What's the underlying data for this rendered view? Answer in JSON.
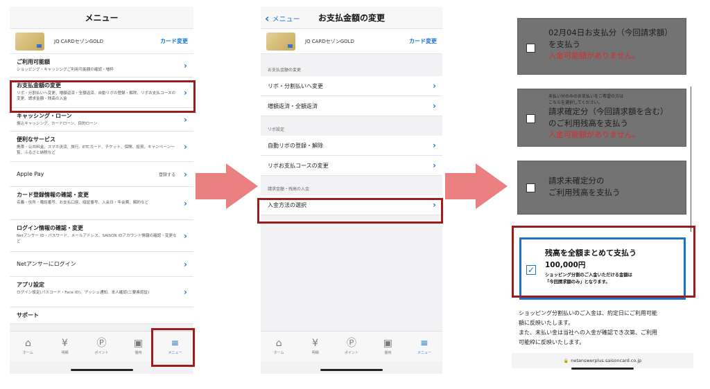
{
  "colors": {
    "accent": "#1a73d9",
    "highlight": "#9b1c1c",
    "arrow": "#ea7f80",
    "selected_border": "#1b74c9",
    "warning": "#d92b2b",
    "disabled_box": "#737373"
  },
  "screen1": {
    "title": "メニュー",
    "card": {
      "name": "JQ CARDセゾンGOLD",
      "change_label": "カード変更"
    },
    "items": [
      {
        "title": "ご利用可能額",
        "sub": "ショッピング・キャッシングご利用可能額の確認・増枠"
      },
      {
        "title": "お支払金額の変更",
        "sub": "リボ・分割払いへ変更、増額返済・全額返済、自動リボの登録・解除、リボお支払コースの変更、請求金額・残高の入金"
      },
      {
        "title": "キャッシング・ローン",
        "sub": "振込キャッシング、カードローン、目的ローン"
      },
      {
        "title": "便利なサービス",
        "sub": "携帯・公共料金、スマホ決済、旅行、ETCカード、チケット、保険、投資、キャンペーン一覧、ふるさと納税など"
      },
      {
        "title": "Apple Pay",
        "sub": "",
        "note": "登録する"
      },
      {
        "title": "カード登録情報の確認・変更",
        "sub": "名義・住所・電話番号、お支払口座、暗証番号、入会日・年会費、解約など"
      },
      {
        "title": "ログイン情報の確認・変更",
        "sub": "Netアンサー ID・パスワード、メールアドレス、SAISON IDアカウント情報の確認・変更など"
      },
      {
        "title": "Netアンサーにログイン",
        "sub": ""
      },
      {
        "title": "アプリ設定",
        "sub": "ログイン設定(パスコード・Face ID)、プッシュ通知、本人確認(二要素認証)"
      },
      {
        "title": "サポート",
        "sub": ""
      }
    ]
  },
  "tabs": [
    {
      "label": "ホーム",
      "icon": "house-icon"
    },
    {
      "label": "明細",
      "icon": "yen-icon"
    },
    {
      "label": "ポイント",
      "icon": "point-icon"
    },
    {
      "label": "優待",
      "icon": "gift-icon"
    },
    {
      "label": "メニュー",
      "icon": "menu-icon"
    }
  ],
  "screen2": {
    "back_label": "メニュー",
    "title": "お支払金額の変更",
    "card": {
      "name": "JQ CARDセゾンGOLD",
      "change_label": "カード変更"
    },
    "sections": [
      {
        "header": "お支払金額の変更",
        "rows": [
          "リボ・分割払いへ変更",
          "増額返済・全額返済"
        ]
      },
      {
        "header": "リボ設定",
        "rows": [
          "自動リボの登録・解除",
          "リボお支払コースの変更"
        ]
      },
      {
        "header": "請求金額・残高の入金",
        "rows": [
          "入金方法の選択"
        ]
      }
    ]
  },
  "screen3": {
    "option1": {
      "line1": "02月04日お支払分（今回請求額）",
      "line2": "を支払う",
      "warning": "入金可能額がありません。"
    },
    "option2": {
      "note1": "未払い分のみのお支払いをご希望の方は",
      "note2": "こちらを選択してください。",
      "line1": "請求確定分（今回請求額を含む）",
      "line2": "のご利用残高を支払う",
      "warning": "入金可能額がありません。"
    },
    "option3": {
      "line1": "請求未確定分の",
      "line2": "ご利用残高を支払う"
    },
    "option4": {
      "title": "残高を全額まとめて支払う",
      "amount": "100,000円",
      "note1": "ショッピング分割のご入金いただける金額は",
      "note2": "「今回請求額のみ」となります。",
      "checked": true
    },
    "info": [
      "ショッピング分割払いのご入金は、約定日にご利用可能",
      "額に反映いたします。",
      "また、未払い金は当社への入金が確認でき次第、ご利用",
      "可能枠に反映いたします。"
    ],
    "url": "netanswerplus.saisoncard.co.jp"
  }
}
